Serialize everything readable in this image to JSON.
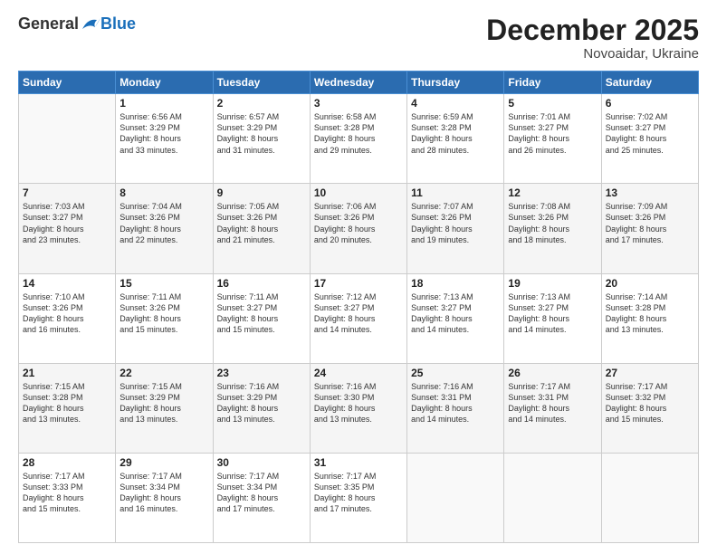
{
  "logo": {
    "general": "General",
    "blue": "Blue"
  },
  "header": {
    "month": "December 2025",
    "location": "Novoaidar, Ukraine"
  },
  "weekdays": [
    "Sunday",
    "Monday",
    "Tuesday",
    "Wednesday",
    "Thursday",
    "Friday",
    "Saturday"
  ],
  "weeks": [
    [
      {
        "day": "",
        "info": ""
      },
      {
        "day": "1",
        "info": "Sunrise: 6:56 AM\nSunset: 3:29 PM\nDaylight: 8 hours\nand 33 minutes."
      },
      {
        "day": "2",
        "info": "Sunrise: 6:57 AM\nSunset: 3:29 PM\nDaylight: 8 hours\nand 31 minutes."
      },
      {
        "day": "3",
        "info": "Sunrise: 6:58 AM\nSunset: 3:28 PM\nDaylight: 8 hours\nand 29 minutes."
      },
      {
        "day": "4",
        "info": "Sunrise: 6:59 AM\nSunset: 3:28 PM\nDaylight: 8 hours\nand 28 minutes."
      },
      {
        "day": "5",
        "info": "Sunrise: 7:01 AM\nSunset: 3:27 PM\nDaylight: 8 hours\nand 26 minutes."
      },
      {
        "day": "6",
        "info": "Sunrise: 7:02 AM\nSunset: 3:27 PM\nDaylight: 8 hours\nand 25 minutes."
      }
    ],
    [
      {
        "day": "7",
        "info": "Sunrise: 7:03 AM\nSunset: 3:27 PM\nDaylight: 8 hours\nand 23 minutes."
      },
      {
        "day": "8",
        "info": "Sunrise: 7:04 AM\nSunset: 3:26 PM\nDaylight: 8 hours\nand 22 minutes."
      },
      {
        "day": "9",
        "info": "Sunrise: 7:05 AM\nSunset: 3:26 PM\nDaylight: 8 hours\nand 21 minutes."
      },
      {
        "day": "10",
        "info": "Sunrise: 7:06 AM\nSunset: 3:26 PM\nDaylight: 8 hours\nand 20 minutes."
      },
      {
        "day": "11",
        "info": "Sunrise: 7:07 AM\nSunset: 3:26 PM\nDaylight: 8 hours\nand 19 minutes."
      },
      {
        "day": "12",
        "info": "Sunrise: 7:08 AM\nSunset: 3:26 PM\nDaylight: 8 hours\nand 18 minutes."
      },
      {
        "day": "13",
        "info": "Sunrise: 7:09 AM\nSunset: 3:26 PM\nDaylight: 8 hours\nand 17 minutes."
      }
    ],
    [
      {
        "day": "14",
        "info": "Sunrise: 7:10 AM\nSunset: 3:26 PM\nDaylight: 8 hours\nand 16 minutes."
      },
      {
        "day": "15",
        "info": "Sunrise: 7:11 AM\nSunset: 3:26 PM\nDaylight: 8 hours\nand 15 minutes."
      },
      {
        "day": "16",
        "info": "Sunrise: 7:11 AM\nSunset: 3:27 PM\nDaylight: 8 hours\nand 15 minutes."
      },
      {
        "day": "17",
        "info": "Sunrise: 7:12 AM\nSunset: 3:27 PM\nDaylight: 8 hours\nand 14 minutes."
      },
      {
        "day": "18",
        "info": "Sunrise: 7:13 AM\nSunset: 3:27 PM\nDaylight: 8 hours\nand 14 minutes."
      },
      {
        "day": "19",
        "info": "Sunrise: 7:13 AM\nSunset: 3:27 PM\nDaylight: 8 hours\nand 14 minutes."
      },
      {
        "day": "20",
        "info": "Sunrise: 7:14 AM\nSunset: 3:28 PM\nDaylight: 8 hours\nand 13 minutes."
      }
    ],
    [
      {
        "day": "21",
        "info": "Sunrise: 7:15 AM\nSunset: 3:28 PM\nDaylight: 8 hours\nand 13 minutes."
      },
      {
        "day": "22",
        "info": "Sunrise: 7:15 AM\nSunset: 3:29 PM\nDaylight: 8 hours\nand 13 minutes."
      },
      {
        "day": "23",
        "info": "Sunrise: 7:16 AM\nSunset: 3:29 PM\nDaylight: 8 hours\nand 13 minutes."
      },
      {
        "day": "24",
        "info": "Sunrise: 7:16 AM\nSunset: 3:30 PM\nDaylight: 8 hours\nand 13 minutes."
      },
      {
        "day": "25",
        "info": "Sunrise: 7:16 AM\nSunset: 3:31 PM\nDaylight: 8 hours\nand 14 minutes."
      },
      {
        "day": "26",
        "info": "Sunrise: 7:17 AM\nSunset: 3:31 PM\nDaylight: 8 hours\nand 14 minutes."
      },
      {
        "day": "27",
        "info": "Sunrise: 7:17 AM\nSunset: 3:32 PM\nDaylight: 8 hours\nand 15 minutes."
      }
    ],
    [
      {
        "day": "28",
        "info": "Sunrise: 7:17 AM\nSunset: 3:33 PM\nDaylight: 8 hours\nand 15 minutes."
      },
      {
        "day": "29",
        "info": "Sunrise: 7:17 AM\nSunset: 3:34 PM\nDaylight: 8 hours\nand 16 minutes."
      },
      {
        "day": "30",
        "info": "Sunrise: 7:17 AM\nSunset: 3:34 PM\nDaylight: 8 hours\nand 17 minutes."
      },
      {
        "day": "31",
        "info": "Sunrise: 7:17 AM\nSunset: 3:35 PM\nDaylight: 8 hours\nand 17 minutes."
      },
      {
        "day": "",
        "info": ""
      },
      {
        "day": "",
        "info": ""
      },
      {
        "day": "",
        "info": ""
      }
    ]
  ]
}
